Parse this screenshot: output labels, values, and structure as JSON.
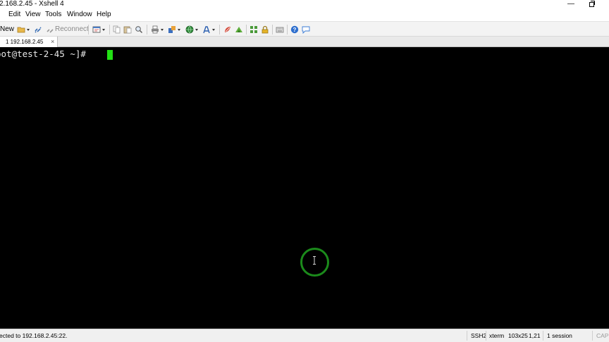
{
  "window": {
    "title": "2.168.2.45 - Xshell 4",
    "minimize_glyph": "—"
  },
  "menu": {
    "items": [
      "Edit",
      "View",
      "Tools",
      "Window",
      "Help"
    ]
  },
  "toolbar": {
    "new_label": "New",
    "reconnect_label": "Reconnect"
  },
  "tabs": [
    {
      "label": "1 192.168.2.45",
      "close_glyph": "×"
    }
  ],
  "terminal": {
    "prompt": "oot@test-2-45 ~]# ",
    "cursor_color": "#22e014",
    "background": "#000000"
  },
  "status": {
    "connection": "ected to 192.168.2.45:22.",
    "protocol": "SSH2",
    "term": "xterm",
    "size": "103x25",
    "cursor_pos": "1,21",
    "sessions": "1 session",
    "cap": "CAP"
  }
}
